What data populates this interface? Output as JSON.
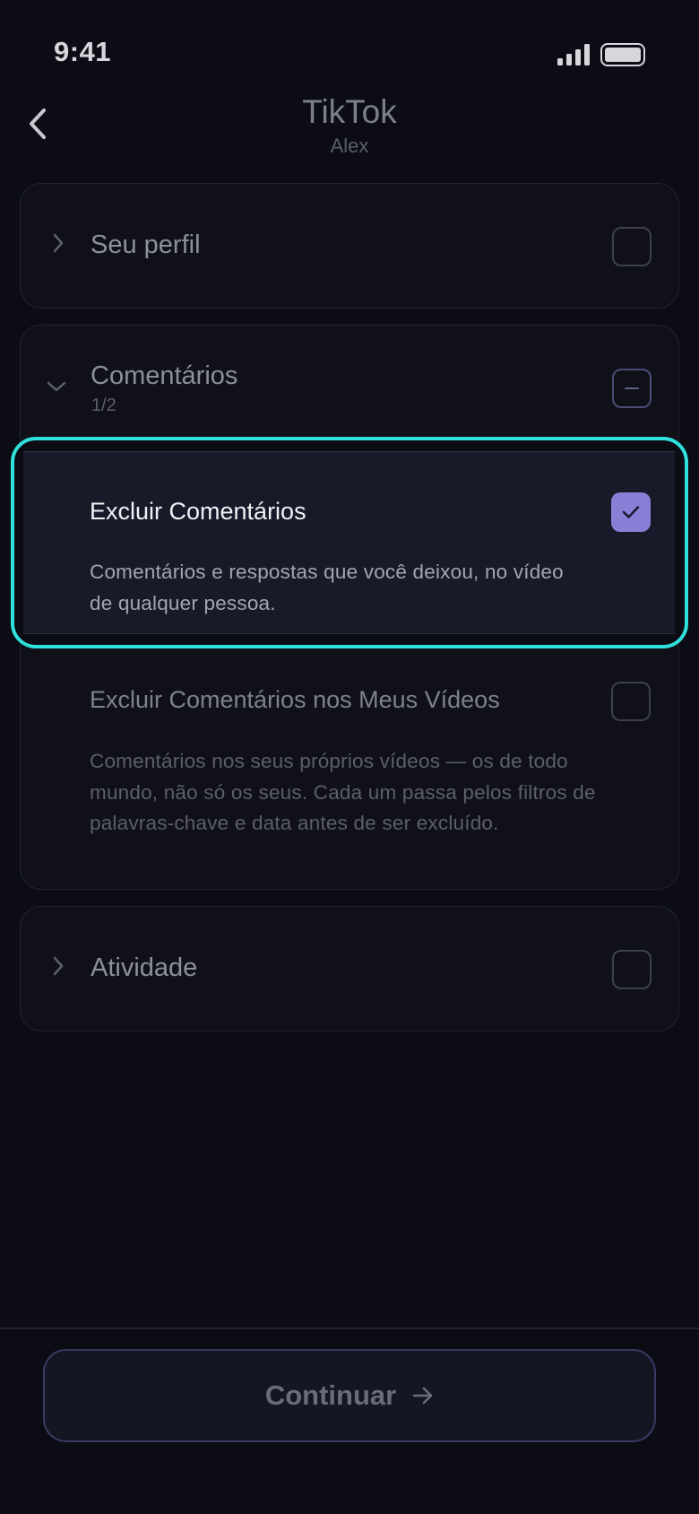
{
  "status_bar": {
    "time": "9:41",
    "icons": [
      "cellular-signal-icon",
      "battery-icon"
    ]
  },
  "header": {
    "title": "TikTok",
    "subtitle": "Alex",
    "back_icon": "chevron-left-icon"
  },
  "sections": [
    {
      "title": "Seu perfil",
      "expanded": false,
      "checkbox_state": "unchecked"
    },
    {
      "title": "Comentários",
      "count": "1/2",
      "expanded": true,
      "checkbox_state": "partial",
      "options": [
        {
          "title": "Excluir Comentários",
          "description": "Comentários e respostas que você deixou, no vídeo de qualquer pessoa.",
          "checked": true,
          "highlighted": true
        },
        {
          "title": "Excluir Comentários nos Meus Vídeos",
          "description": "Comentários nos seus próprios vídeos — os de todo mundo, não só os seus. Cada um passa pelos filtros de palavras-chave e data antes de ser excluído.",
          "checked": false,
          "highlighted": false
        }
      ]
    },
    {
      "title": "Atividade",
      "expanded": false,
      "checkbox_state": "unchecked"
    }
  ],
  "footer": {
    "continue_label": "Continuar",
    "continue_icon": "arrow-right-icon"
  },
  "colors": {
    "background": "#0b0c14",
    "accent_checkbox": "#8a7fd6",
    "highlight_border": "#2fe0dc"
  }
}
